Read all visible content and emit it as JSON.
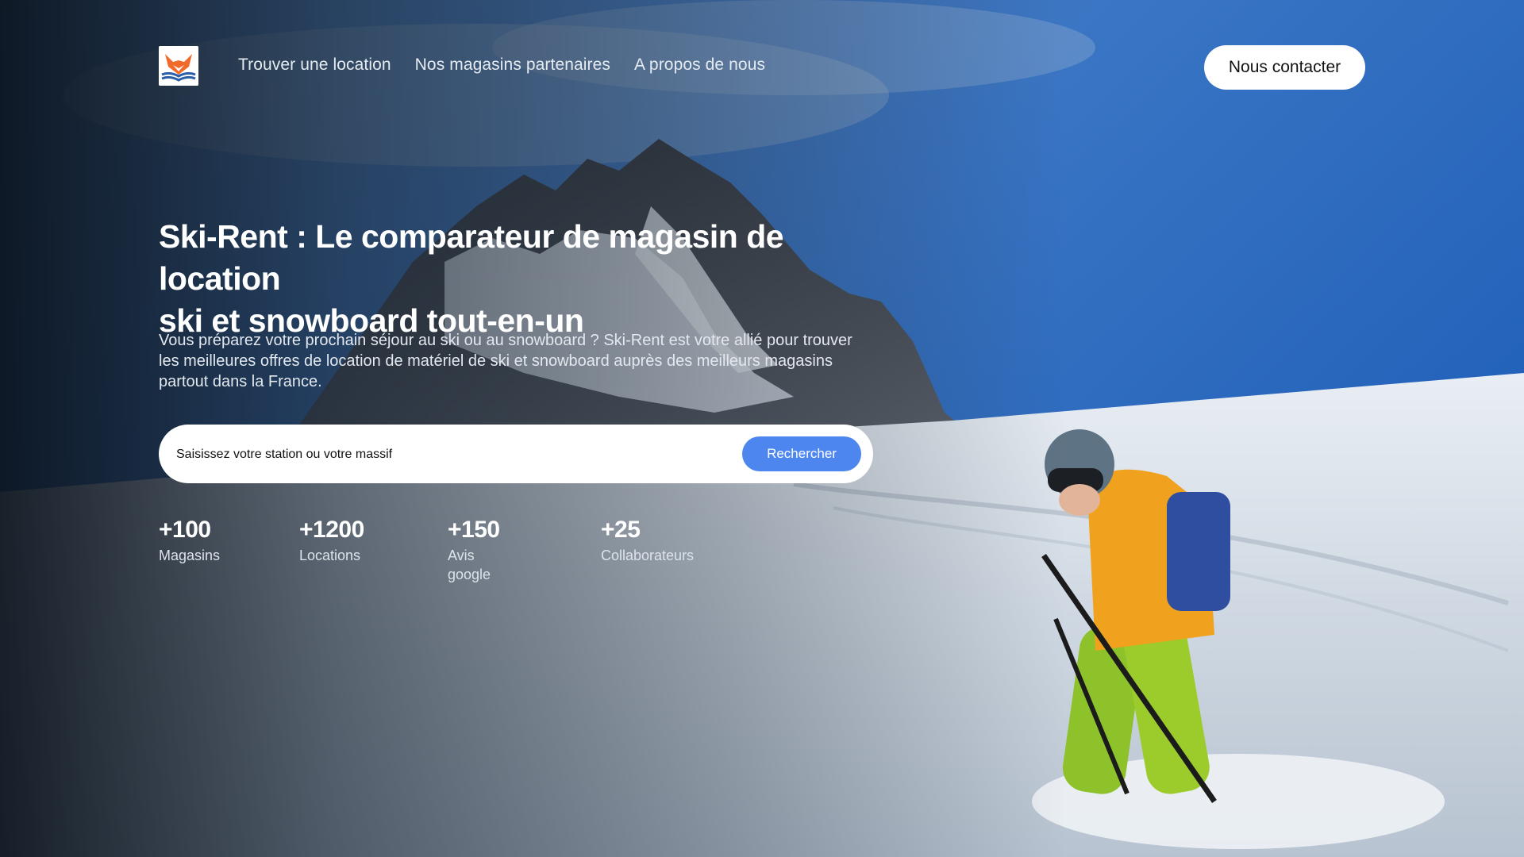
{
  "header": {
    "logo_alt": "Ski-Rent",
    "nav": [
      {
        "label": "Trouver une location"
      },
      {
        "label": "Nos magasins partenaires"
      },
      {
        "label": "A propos de nous"
      }
    ],
    "contact_label": "Nous contacter"
  },
  "hero": {
    "title_line1": "Ski-Rent : Le comparateur de magasin de location",
    "title_line2": "ski et snowboard tout-en-un",
    "lead": "Vous préparez votre prochain séjour au ski ou au snowboard ? Ski-Rent est votre allié pour trouver les meilleures offres de location de matériel de ski et snowboard auprès des meilleurs magasins partout dans la France.",
    "search": {
      "placeholder": "Saisissez votre station ou votre massif",
      "button_label": "Rechercher"
    }
  },
  "stats": [
    {
      "value": "+100",
      "label": "Magasins"
    },
    {
      "value": "+1200",
      "label": "Locations"
    },
    {
      "value": "+150",
      "label": "Avis google"
    },
    {
      "value": "+25",
      "label": "Collaborateurs"
    }
  ],
  "colors": {
    "accent": "#4e86f0",
    "sky": "#2b6bc4",
    "logo_orange": "#f26a2a",
    "logo_blue": "#2a5ea8"
  },
  "icons": [
    "fox-book-logo-icon"
  ]
}
